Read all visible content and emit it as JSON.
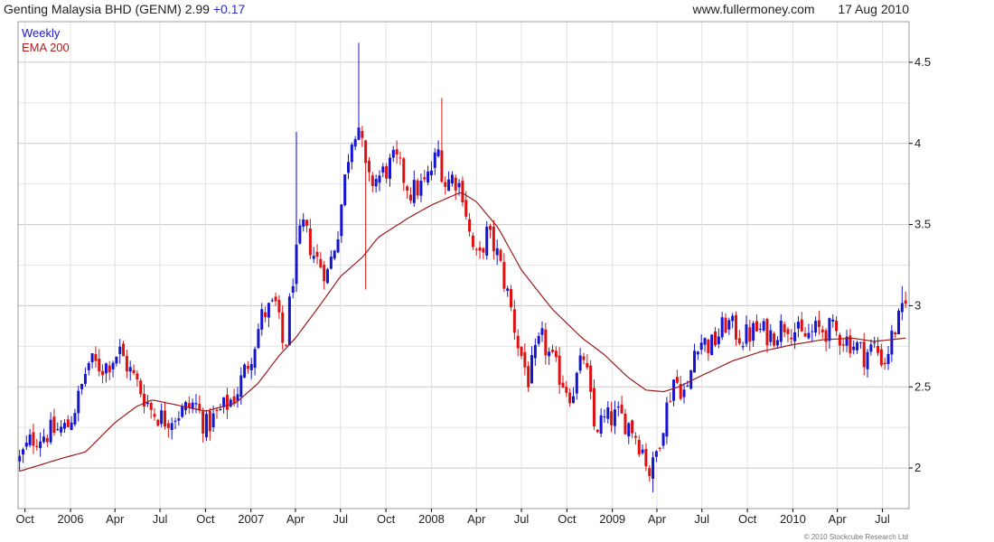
{
  "header": {
    "title": "Genting Malaysia BHD (GENM)",
    "last": "2.99",
    "change": "+0.17",
    "site": "www.fullermoney.com",
    "date": "17 Aug 2010"
  },
  "footer": {
    "copyright": "© 2010 Stockcube Research Ltd"
  },
  "colors": {
    "up": "#1515d0",
    "down": "#dd1111",
    "ema": "#9b1a1a",
    "grid": "#cfcfcf",
    "axis": "#000000"
  },
  "chart_data": {
    "type": "candlestick",
    "interval": "Weekly",
    "legend": [
      "Weekly",
      "EMA 200"
    ],
    "legend_placement": "top-left",
    "y_axis": {
      "side": "right",
      "ylim": [
        1.75,
        4.75
      ],
      "ticks": [
        2,
        2.5,
        3,
        3.5,
        4,
        4.5
      ]
    },
    "grid": true,
    "x_axis": {
      "tick_labels": [
        "Oct",
        "2006",
        "Apr",
        "Jul",
        "Oct",
        "2007",
        "Apr",
        "Jul",
        "Oct",
        "2008",
        "Apr",
        "Jul",
        "Oct",
        "2009",
        "Apr",
        "Jul",
        "Oct",
        "2010",
        "Apr",
        "Jul"
      ],
      "start": "2005-10",
      "end": "2010-08"
    },
    "price_anchors": [
      [
        "2005-09-20",
        2.05
      ],
      [
        "2005-10-15",
        2.18
      ],
      [
        "2005-11-20",
        2.22
      ],
      [
        "2005-12-25",
        2.25
      ],
      [
        "2006-01-20",
        2.45
      ],
      [
        "2006-02-05",
        2.65
      ],
      [
        "2006-03-10",
        2.62
      ],
      [
        "2006-04-10",
        2.72
      ],
      [
        "2006-05-01",
        2.6
      ],
      [
        "2006-06-15",
        2.35
      ],
      [
        "2006-07-10",
        2.3
      ],
      [
        "2006-08-15",
        2.35
      ],
      [
        "2006-09-10",
        2.4
      ],
      [
        "2006-10-01",
        2.25
      ],
      [
        "2006-11-01",
        2.35
      ],
      [
        "2006-12-01",
        2.45
      ],
      [
        "2007-01-01",
        2.7
      ],
      [
        "2007-01-25",
        2.95
      ],
      [
        "2007-02-20",
        3.0
      ],
      [
        "2007-03-10",
        2.7
      ],
      [
        "2007-03-25",
        3.15
      ],
      [
        "2007-04-15",
        3.5
      ],
      [
        "2007-05-10",
        3.3
      ],
      [
        "2007-06-05",
        3.2
      ],
      [
        "2007-06-25",
        3.45
      ],
      [
        "2007-07-20",
        4.0
      ],
      [
        "2007-08-05",
        4.15
      ],
      [
        "2007-08-25",
        3.75
      ],
      [
        "2007-09-20",
        3.8
      ],
      [
        "2007-10-20",
        3.9
      ],
      [
        "2007-11-20",
        3.7
      ],
      [
        "2007-12-20",
        3.75
      ],
      [
        "2008-01-15",
        3.95
      ],
      [
        "2008-01-28",
        3.75
      ],
      [
        "2008-02-15",
        3.8
      ],
      [
        "2008-03-05",
        3.7
      ],
      [
        "2008-03-20",
        3.4
      ],
      [
        "2008-04-05",
        3.25
      ],
      [
        "2008-04-20",
        3.45
      ],
      [
        "2008-05-10",
        3.35
      ],
      [
        "2008-06-05",
        3.05
      ],
      [
        "2008-06-25",
        2.75
      ],
      [
        "2008-07-15",
        2.55
      ],
      [
        "2008-08-10",
        2.8
      ],
      [
        "2008-09-10",
        2.6
      ],
      [
        "2008-10-10",
        2.45
      ],
      [
        "2008-11-05",
        2.7
      ],
      [
        "2008-11-25",
        2.25
      ],
      [
        "2008-12-20",
        2.3
      ],
      [
        "2009-01-15",
        2.32
      ],
      [
        "2009-02-10",
        2.25
      ],
      [
        "2009-03-05",
        2.1
      ],
      [
        "2009-03-20",
        1.95
      ],
      [
        "2009-04-15",
        2.3
      ],
      [
        "2009-05-05",
        2.55
      ],
      [
        "2009-06-01",
        2.45
      ],
      [
        "2009-06-20",
        2.8
      ],
      [
        "2009-07-20",
        2.75
      ],
      [
        "2009-08-20",
        2.9
      ],
      [
        "2009-09-20",
        2.8
      ],
      [
        "2009-10-20",
        2.85
      ],
      [
        "2009-11-20",
        2.82
      ],
      [
        "2009-12-20",
        2.9
      ],
      [
        "2010-01-20",
        2.8
      ],
      [
        "2010-02-20",
        2.85
      ],
      [
        "2010-03-20",
        2.85
      ],
      [
        "2010-04-15",
        2.8
      ],
      [
        "2010-05-10",
        2.75
      ],
      [
        "2010-05-25",
        2.7
      ],
      [
        "2010-06-15",
        2.75
      ],
      [
        "2010-07-05",
        2.65
      ],
      [
        "2010-07-25",
        2.85
      ],
      [
        "2010-08-17",
        2.99
      ]
    ],
    "spikes": [
      {
        "date": "2007-04-01",
        "high": 4.07
      },
      {
        "date": "2007-08-05",
        "high": 4.62
      },
      {
        "date": "2007-08-20",
        "low": 3.1
      },
      {
        "date": "2008-01-25",
        "high": 4.28
      },
      {
        "date": "2009-03-25",
        "low": 1.85
      },
      {
        "date": "2010-08-10",
        "high": 3.12
      }
    ],
    "ema_anchors": [
      [
        "2005-09-20",
        1.98
      ],
      [
        "2005-12-15",
        2.06
      ],
      [
        "2006-02-01",
        2.1
      ],
      [
        "2006-04-01",
        2.28
      ],
      [
        "2006-05-15",
        2.38
      ],
      [
        "2006-06-15",
        2.42
      ],
      [
        "2006-08-01",
        2.39
      ],
      [
        "2006-10-01",
        2.35
      ],
      [
        "2006-12-01",
        2.4
      ],
      [
        "2007-01-15",
        2.52
      ],
      [
        "2007-03-01",
        2.7
      ],
      [
        "2007-04-01",
        2.8
      ],
      [
        "2007-05-15",
        2.98
      ],
      [
        "2007-07-01",
        3.18
      ],
      [
        "2007-08-15",
        3.3
      ],
      [
        "2007-09-15",
        3.42
      ],
      [
        "2007-11-15",
        3.54
      ],
      [
        "2008-01-01",
        3.62
      ],
      [
        "2008-03-01",
        3.7
      ],
      [
        "2008-04-01",
        3.64
      ],
      [
        "2008-05-15",
        3.48
      ],
      [
        "2008-07-01",
        3.22
      ],
      [
        "2008-09-01",
        2.98
      ],
      [
        "2008-11-01",
        2.8
      ],
      [
        "2008-12-15",
        2.7
      ],
      [
        "2009-02-01",
        2.56
      ],
      [
        "2009-03-10",
        2.48
      ],
      [
        "2009-04-15",
        2.47
      ],
      [
        "2009-05-15",
        2.5
      ],
      [
        "2009-07-01",
        2.57
      ],
      [
        "2009-09-01",
        2.66
      ],
      [
        "2009-11-01",
        2.72
      ],
      [
        "2010-01-01",
        2.76
      ],
      [
        "2010-03-01",
        2.79
      ],
      [
        "2010-05-01",
        2.8
      ],
      [
        "2010-06-15",
        2.78
      ],
      [
        "2010-08-17",
        2.8
      ]
    ]
  }
}
